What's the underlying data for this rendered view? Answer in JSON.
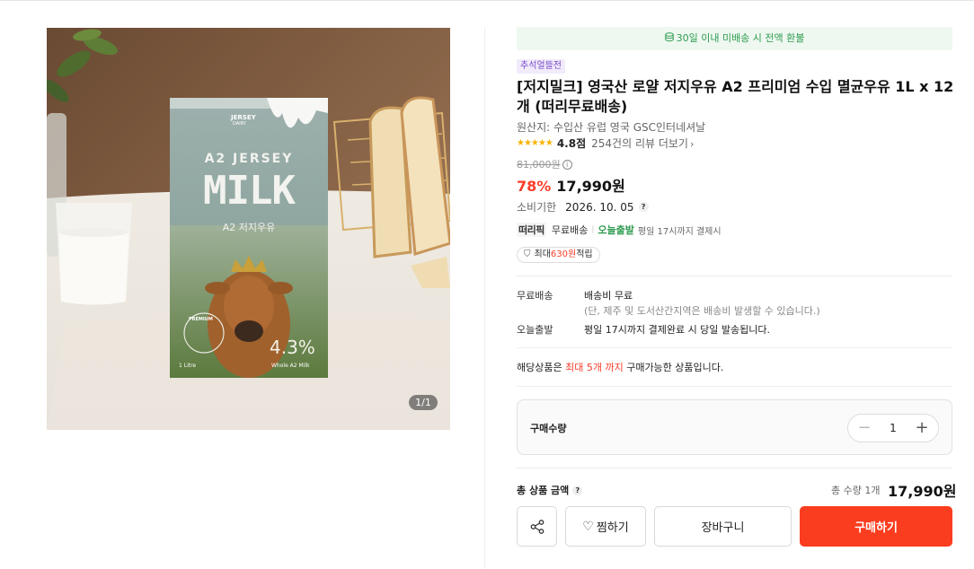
{
  "gallery": {
    "counter": "1/1",
    "product_art": {
      "brand_line1": "JERSEY",
      "brand_line2": "DAIRY",
      "headline": "A2 JERSEY",
      "big_word": "MILK",
      "subtitle": "A2 저지우유",
      "badge": "PREMIUM",
      "fat": "4.3%",
      "volume": "1 Litre",
      "note": "Whole A2 Milk"
    }
  },
  "refund_banner": "30일 이내 미배송 시 전액 환불",
  "promo_tag": "추석얼뜰전",
  "title": "[저지밀크] 영국산 로얄 저지우유 A2 프리미엄 수입 멸균우유 1L x 12개 (떠리무료배송)",
  "origin": "원산지: 수입산 유럽 영국 GSC인터네셔날",
  "rating": {
    "stars": 5,
    "score": "4.8점",
    "reviews": "254건의 리뷰 더보기"
  },
  "original_price": "81,000원",
  "discount": "78%",
  "price": "17,990원",
  "expiry": {
    "label": "소비기한",
    "date": "2026. 10. 05"
  },
  "shipping": {
    "logo": "떠리픽",
    "free": "무료배송",
    "today": "오늘출발",
    "note": "평일 17시까지 결제시"
  },
  "points": {
    "prefix": "최대 ",
    "amount": "630원",
    "suffix": " 적립"
  },
  "delivery_info": {
    "free_label": "무료배송",
    "free_value": "배송비 무료",
    "free_sub": "(단, 제주 및 도서산간지역은 배송비 발생할 수 있습니다.)",
    "today_label": "오늘출발",
    "today_value": "평일 17시까지 결제완료 시 당일 발송됩니다."
  },
  "limit_note": {
    "pre": "해당상품은 ",
    "red": "최대 5개 까지",
    "post": " 구매가능한 상품입니다."
  },
  "quantity": {
    "label": "구매수량",
    "value": "1"
  },
  "total": {
    "label": "총 상품 금액",
    "qty": "총 수량 1개",
    "price": "17,990원"
  },
  "buttons": {
    "wish": "찜하기",
    "cart": "장바구니",
    "buy": "구매하기"
  },
  "colors": {
    "accent_red": "#fa3d1f",
    "green": "#2f9b50",
    "purple_tag": "#7b4cc9"
  }
}
